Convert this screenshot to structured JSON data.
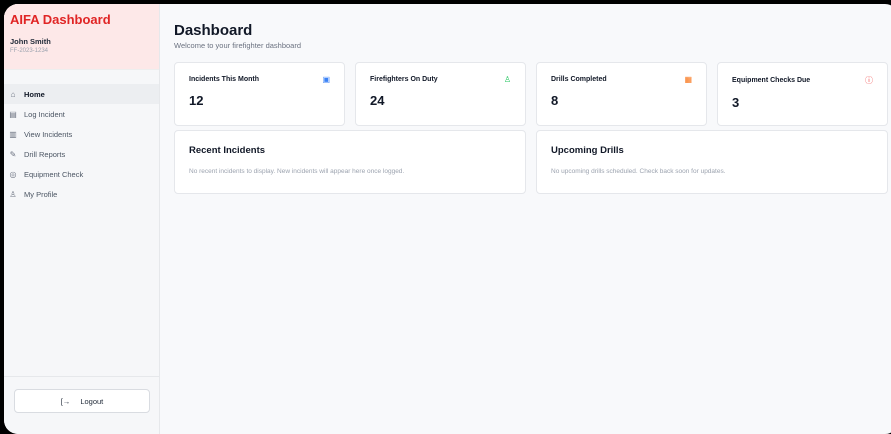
{
  "sidebar": {
    "brand": "AIFA Dashboard",
    "user_name": "John Smith",
    "user_id": "FF-2023-1234",
    "items": [
      {
        "label": "Home",
        "icon": "home-icon",
        "glyph": "⌂"
      },
      {
        "label": "Log Incident",
        "icon": "clipboard-icon",
        "glyph": "▤"
      },
      {
        "label": "View Incidents",
        "icon": "document-icon",
        "glyph": "▥"
      },
      {
        "label": "Drill Reports",
        "icon": "wrench-icon",
        "glyph": "✎"
      },
      {
        "label": "Equipment Check",
        "icon": "shield-icon",
        "glyph": "◎"
      },
      {
        "label": "My Profile",
        "icon": "user-icon",
        "glyph": "♙"
      }
    ],
    "logout_label": "Logout"
  },
  "header": {
    "title": "Dashboard",
    "subtitle": "Welcome to your firefighter dashboard"
  },
  "stats": [
    {
      "label": "Incidents This Month",
      "value": "12",
      "icon": "clipboard-icon",
      "color": "#3b82f6"
    },
    {
      "label": "Firefighters On Duty",
      "value": "24",
      "icon": "users-icon",
      "color": "#22c55e"
    },
    {
      "label": "Drills Completed",
      "value": "8",
      "icon": "calendar-icon",
      "color": "#f97316"
    },
    {
      "label": "Equipment Checks Due",
      "value": "3",
      "icon": "alert-icon",
      "color": "#ef4444"
    }
  ],
  "panels": {
    "recent_incidents": {
      "title": "Recent Incidents",
      "text": "No recent incidents to display. New incidents will appear here once logged."
    },
    "upcoming_drills": {
      "title": "Upcoming Drills",
      "text": "No upcoming drills scheduled. Check back soon for updates."
    }
  },
  "colors": {
    "brand": "#e02424",
    "brand_bg": "#fde8e8"
  }
}
